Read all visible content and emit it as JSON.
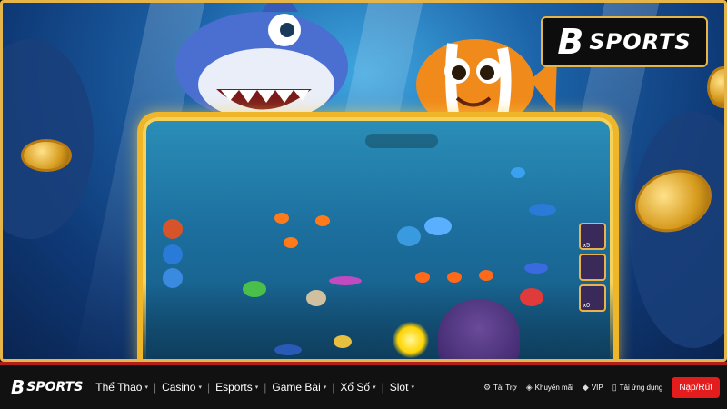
{
  "brand": {
    "logo_mark": "B",
    "logo_text": "SPORTS"
  },
  "nav": {
    "items": [
      {
        "label": "Thể Thao"
      },
      {
        "label": "Casino"
      },
      {
        "label": "Esports"
      },
      {
        "label": "Game Bài"
      },
      {
        "label": "Xổ Số"
      },
      {
        "label": "Slot"
      }
    ],
    "caret": "▾",
    "separator": "|"
  },
  "right_links": [
    {
      "label": "Tài Trợ",
      "icon": "sponsor-icon",
      "glyph": "⚙"
    },
    {
      "label": "Khuyến mãi",
      "icon": "tag-icon",
      "glyph": "◈"
    },
    {
      "label": "VIP",
      "icon": "diamond-icon",
      "glyph": "◆"
    },
    {
      "label": "Tải ứng dụng",
      "icon": "phone-icon",
      "glyph": "▯"
    }
  ],
  "deposit_button": "Nạp/Rút",
  "game": {
    "tools": [
      {
        "label": "x5"
      },
      {
        "label": ""
      },
      {
        "label": "x0"
      }
    ]
  },
  "colors": {
    "accent_gold": "#e6b54a",
    "nav_red": "#b11e1e",
    "deposit_red": "#e31d1d"
  }
}
